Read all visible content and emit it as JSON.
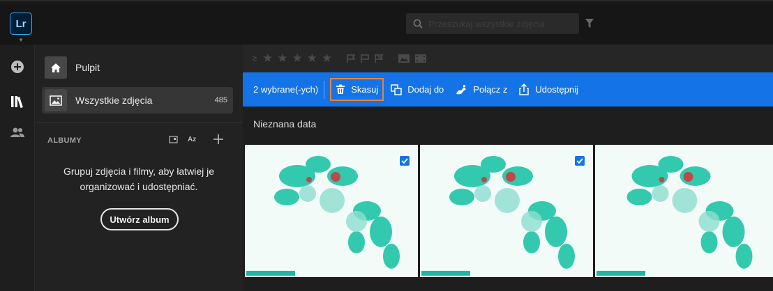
{
  "app": {
    "logo": "Lr"
  },
  "search": {
    "placeholder": "Przeszukaj wszystkie zdjęcia"
  },
  "sidebar": {
    "items": [
      {
        "label": "Pulpit",
        "icon": "home-icon"
      },
      {
        "label": "Wszystkie zdjęcia",
        "count": "485",
        "icon": "photos-icon"
      }
    ],
    "albums_header": "ALBUMY",
    "sort_label": "Az",
    "empty_message": "Grupuj zdjęcia i filmy, aby łatwiej je organizować i udostępniać.",
    "create_album": "Utwórz album"
  },
  "filterbar": {
    "min_rating_symbol": "≥",
    "stars": 5
  },
  "actionbar": {
    "selected": "2 wybrane(-ych)",
    "delete": "Skasuj",
    "add_to": "Dodaj do",
    "merge": "Połącz z",
    "share": "Udostępnij"
  },
  "grid": {
    "date_header": "Nieznana data",
    "photos": [
      {
        "selected": true
      },
      {
        "selected": true
      },
      {
        "selected": false
      }
    ]
  },
  "colors": {
    "accent": "#1473e6",
    "focus": "#e8843a"
  }
}
